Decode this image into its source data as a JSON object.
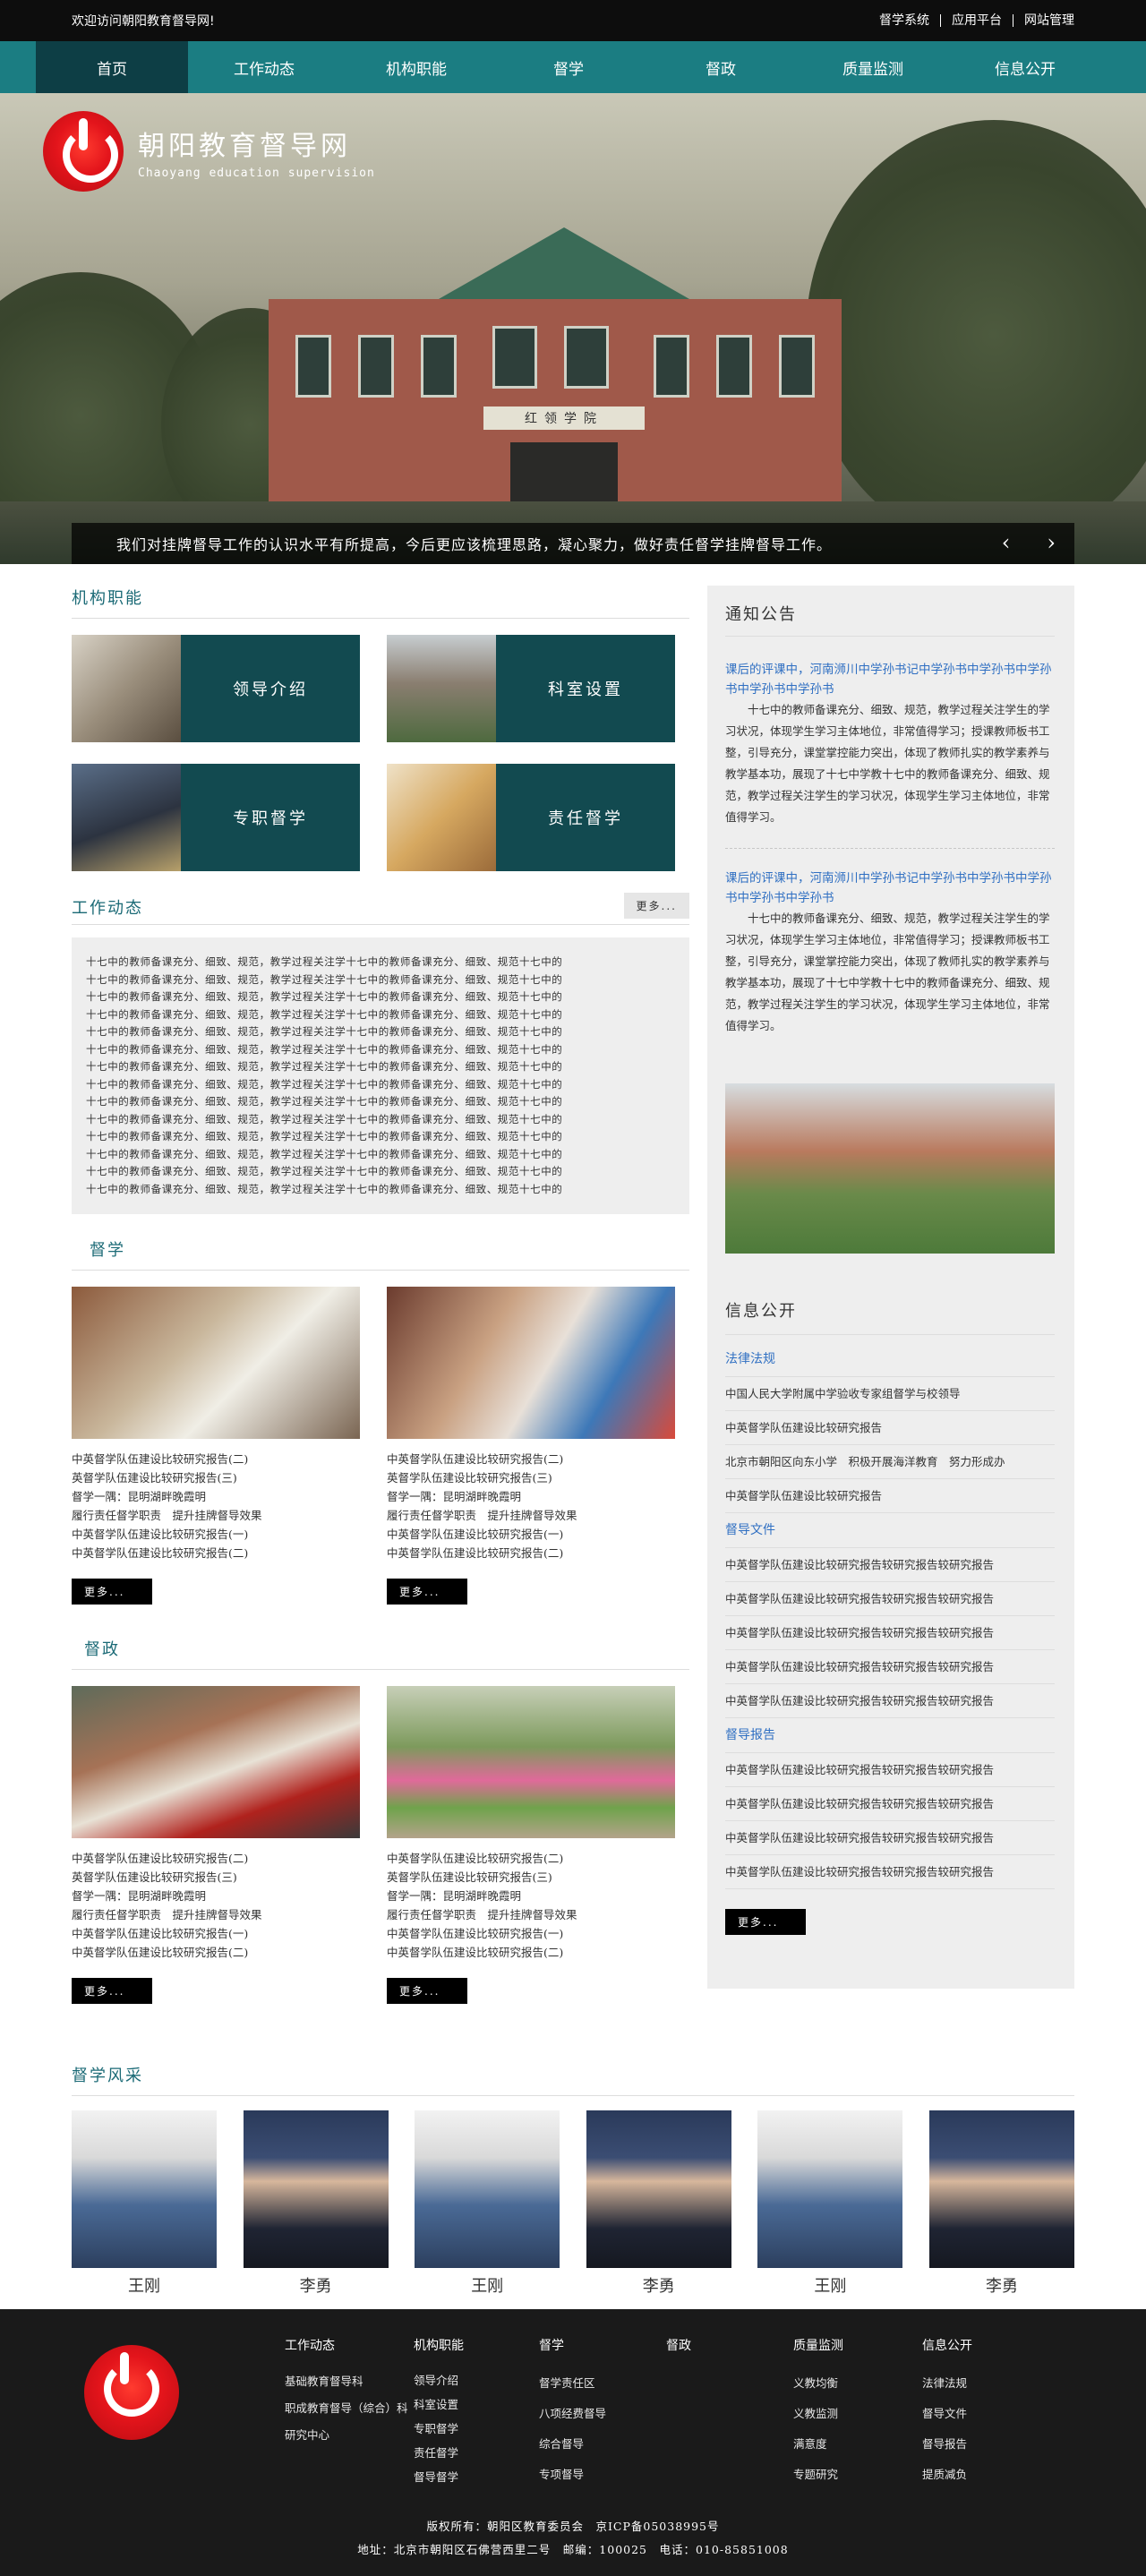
{
  "topbar": {
    "welcome": "欢迎访问朝阳教育督导网!",
    "links": [
      "督学系统",
      "应用平台",
      "网站管理"
    ]
  },
  "nav": [
    "首页",
    "工作动态",
    "机构职能",
    "督学",
    "督政",
    "质量监测",
    "信息公开"
  ],
  "banner": {
    "site_name": "朝阳教育督导网",
    "site_name_en": "Chaoyang education supervision",
    "building_sign": "红领学院",
    "caption": "我们对挂牌督导工作的认识水平有所提高，今后更应该梳理思路，凝心聚力，做好责任督学挂牌督导工作。",
    "prev": "‹",
    "next": "›"
  },
  "org": {
    "title": "机构职能",
    "tiles": [
      {
        "label": "领导介绍"
      },
      {
        "label": "科室设置"
      },
      {
        "label": "专职督学"
      },
      {
        "label": "责任督学"
      }
    ]
  },
  "news": {
    "title": "工作动态",
    "more": "更多...",
    "lines": [
      "十七中的教师备课充分、细致、规范，教学过程关注学十七中的教师备课充分、细致、规范十七中的",
      "十七中的教师备课充分、细致、规范，教学过程关注学十七中的教师备课充分、细致、规范十七中的",
      "十七中的教师备课充分、细致、规范，教学过程关注学十七中的教师备课充分、细致、规范十七中的",
      "十七中的教师备课充分、细致、规范，教学过程关注学十七中的教师备课充分、细致、规范十七中的",
      "十七中的教师备课充分、细致、规范，教学过程关注学十七中的教师备课充分、细致、规范十七中的",
      "十七中的教师备课充分、细致、规范，教学过程关注学十七中的教师备课充分、细致、规范十七中的",
      "十七中的教师备课充分、细致、规范，教学过程关注学十七中的教师备课充分、细致、规范十七中的",
      "十七中的教师备课充分、细致、规范，教学过程关注学十七中的教师备课充分、细致、规范十七中的",
      "十七中的教师备课充分、细致、规范，教学过程关注学十七中的教师备课充分、细致、规范十七中的",
      "十七中的教师备课充分、细致、规范，教学过程关注学十七中的教师备课充分、细致、规范十七中的",
      "十七中的教师备课充分、细致、规范，教学过程关注学十七中的教师备课充分、细致、规范十七中的",
      "十七中的教师备课充分、细致、规范，教学过程关注学十七中的教师备课充分、细致、规范十七中的",
      "十七中的教师备课充分、细致、规范，教学过程关注学十七中的教师备课充分、细致、规范十七中的",
      "十七中的教师备课充分、细致、规范，教学过程关注学十七中的教师备课充分、细致、规范十七中的"
    ]
  },
  "duxue": {
    "title": "督学",
    "more": "更多...",
    "cards": [
      {
        "items": [
          "中英督学队伍建设比较研究报告(二)",
          "英督学队伍建设比较研究报告(三)",
          "督学一隅：昆明湖畔晚霞明",
          "履行责任督学职责　提升挂牌督导效果",
          "中英督学队伍建设比较研究报告(一)",
          "中英督学队伍建设比较研究报告(二)"
        ]
      },
      {
        "items": [
          "中英督学队伍建设比较研究报告(二)",
          "英督学队伍建设比较研究报告(三)",
          "督学一隅：昆明湖畔晚霞明",
          "履行责任督学职责　提升挂牌督导效果",
          "中英督学队伍建设比较研究报告(一)",
          "中英督学队伍建设比较研究报告(二)"
        ]
      }
    ]
  },
  "duzheng": {
    "title": "督政",
    "more": "更多...",
    "cards": [
      {
        "items": [
          "中英督学队伍建设比较研究报告(二)",
          "英督学队伍建设比较研究报告(三)",
          "督学一隅：昆明湖畔晚霞明",
          "履行责任督学职责　提升挂牌督导效果",
          "中英督学队伍建设比较研究报告(一)",
          "中英督学队伍建设比较研究报告(二)"
        ]
      },
      {
        "items": [
          "中英督学队伍建设比较研究报告(二)",
          "英督学队伍建设比较研究报告(三)",
          "督学一隅：昆明湖畔晚霞明",
          "履行责任督学职责　提升挂牌督导效果",
          "中英督学队伍建设比较研究报告(一)",
          "中英督学队伍建设比较研究报告(二)"
        ]
      }
    ]
  },
  "notice": {
    "title": "通知公告",
    "items": [
      {
        "head": "课后的评课中，河南浉川中学孙书记中学孙书中学孙书中学孙书中学孙书中学孙书",
        "body": "十七中的教师备课充分、细致、规范，教学过程关注学生的学习状况，体现学生学习主体地位，非常值得学习；授课教师板书工整，引导充分，课堂掌控能力突出，体现了教师扎实的教学素养与教学基本功，展现了十七中学教十七中的教师备课充分、细致、规范，教学过程关注学生的学习状况，体现学生学习主体地位，非常值得学习。"
      },
      {
        "head": "课后的评课中，河南浉川中学孙书记中学孙书中学孙书中学孙书中学孙书中学孙书",
        "body": "十七中的教师备课充分、细致、规范，教学过程关注学生的学习状况，体现学生学习主体地位，非常值得学习；授课教师板书工整，引导充分，课堂掌控能力突出，体现了教师扎实的教学素养与教学基本功，展现了十七中学教十七中的教师备课充分、细致、规范，教学过程关注学生的学习状况，体现学生学习主体地位，非常值得学习。"
      }
    ]
  },
  "info": {
    "title": "信息公开",
    "more": "更多...",
    "groups": [
      {
        "sub": "法律法规",
        "rows": [
          "中国人民大学附属中学验收专家组督学与校领导",
          "中英督学队伍建设比较研究报告",
          "北京市朝阳区向东小学　积极开展海洋教育　努力形成办",
          "中英督学队伍建设比较研究报告"
        ]
      },
      {
        "sub": "督导文件",
        "rows": [
          "中英督学队伍建设比较研究报告较研究报告较研究报告",
          "中英督学队伍建设比较研究报告较研究报告较研究报告",
          "中英督学队伍建设比较研究报告较研究报告较研究报告",
          "中英督学队伍建设比较研究报告较研究报告较研究报告",
          "中英督学队伍建设比较研究报告较研究报告较研究报告"
        ]
      },
      {
        "sub": "督导报告",
        "rows": [
          "中英督学队伍建设比较研究报告较研究报告较研究报告",
          "中英督学队伍建设比较研究报告较研究报告较研究报告",
          "中英督学队伍建设比较研究报告较研究报告较研究报告",
          "中英督学队伍建设比较研究报告较研究报告较研究报告"
        ]
      }
    ]
  },
  "gallery": {
    "title": "督学风采",
    "people": [
      {
        "name": "王刚"
      },
      {
        "name": "李勇"
      },
      {
        "name": "王刚"
      },
      {
        "name": "李勇"
      },
      {
        "name": "王刚"
      },
      {
        "name": "李勇"
      }
    ]
  },
  "footer": {
    "cols": [
      {
        "head": "工作动态",
        "items": [
          "基础教育督导科",
          "职成教育督导（综合）科",
          "研究中心"
        ]
      },
      {
        "head": "机构职能",
        "items": [
          "领导介绍",
          "科室设置",
          "专职督学",
          "责任督学",
          "督导督学"
        ]
      },
      {
        "head": "督学",
        "items": [
          "督学责任区",
          "八项经费督导",
          "综合督导",
          "专项督导"
        ]
      },
      {
        "head": "督政",
        "items": []
      },
      {
        "head": "质量监测",
        "items": [
          "义教均衡",
          "义教监测",
          "满意度",
          "专题研究"
        ]
      },
      {
        "head": "信息公开",
        "items": [
          "法律法规",
          "督导文件",
          "督导报告",
          "提质减负"
        ]
      }
    ],
    "copyright": "版权所有：朝阳区教育委员会　京ICP备05038995号",
    "address": "地址：北京市朝阳区石佛营西里二号　邮编：100025　电话：010-85851008"
  },
  "colors": {
    "nav_bg": "#1b7d82",
    "nav_active": "#0d3e45",
    "tile_bg": "#124a50",
    "section_title": "#1b6a76",
    "link_blue": "#2f6fc2",
    "footer_bg": "#1a1a1a"
  }
}
